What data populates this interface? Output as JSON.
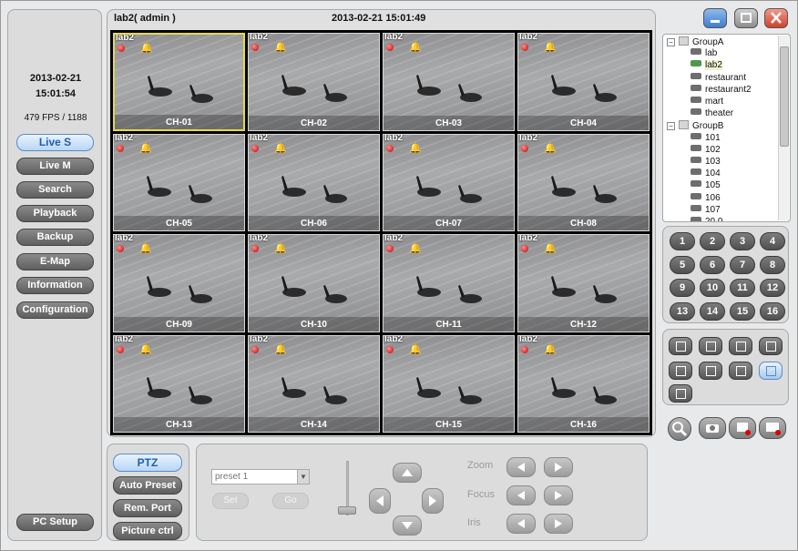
{
  "window": {
    "title": "lab2( admin )",
    "datetime": "2013-02-21    15:01:49"
  },
  "status": {
    "date": "2013-02-21",
    "time": "15:01:54",
    "fps": "479 FPS / 1188"
  },
  "menu": [
    {
      "label": "Live S",
      "active": true
    },
    {
      "label": "Live M",
      "active": false
    },
    {
      "label": "Search",
      "active": false
    },
    {
      "label": "Playback",
      "active": false
    },
    {
      "label": "Backup",
      "active": false
    },
    {
      "label": "E-Map",
      "active": false
    },
    {
      "label": "Information",
      "active": false
    },
    {
      "label": "Configuration",
      "active": false
    }
  ],
  "pc_setup_label": "PC Setup",
  "camera_label": "lab2",
  "channels": [
    "CH-01",
    "CH-02",
    "CH-03",
    "CH-04",
    "CH-05",
    "CH-06",
    "CH-07",
    "CH-08",
    "CH-09",
    "CH-10",
    "CH-11",
    "CH-12",
    "CH-13",
    "CH-14",
    "CH-15",
    "CH-16"
  ],
  "selected_channel": "CH-01",
  "tree": [
    {
      "label": "GroupA",
      "type": "group"
    },
    {
      "label": "lab",
      "type": "device"
    },
    {
      "label": "lab2",
      "type": "device",
      "selected": true
    },
    {
      "label": "restaurant",
      "type": "device"
    },
    {
      "label": "restaurant2",
      "type": "device"
    },
    {
      "label": "mart",
      "type": "device"
    },
    {
      "label": "theater",
      "type": "device"
    },
    {
      "label": "GroupB",
      "type": "group"
    },
    {
      "label": "101",
      "type": "device"
    },
    {
      "label": "102",
      "type": "device"
    },
    {
      "label": "103",
      "type": "device"
    },
    {
      "label": "104",
      "type": "device"
    },
    {
      "label": "105",
      "type": "device"
    },
    {
      "label": "106",
      "type": "device"
    },
    {
      "label": "107",
      "type": "device"
    },
    {
      "label": "20.0",
      "type": "device"
    }
  ],
  "numpad": [
    "1",
    "2",
    "3",
    "4",
    "5",
    "6",
    "7",
    "8",
    "9",
    "10",
    "11",
    "12",
    "13",
    "14",
    "15",
    "16"
  ],
  "ptz_tabs": [
    {
      "label": "PTZ",
      "active": true
    },
    {
      "label": "Auto Preset",
      "active": false
    },
    {
      "label": "Rem. Port",
      "active": false
    },
    {
      "label": "Picture ctrl",
      "active": false
    }
  ],
  "ptz": {
    "preset_value": "preset 1",
    "set_label": "Set",
    "go_label": "Go",
    "zoom_label": "Zoom",
    "focus_label": "Focus",
    "iris_label": "Iris"
  },
  "colors": {
    "accent": "#1f5fb0",
    "selected_border": "#e5d84a",
    "button_dark": "#5f5f5f"
  }
}
